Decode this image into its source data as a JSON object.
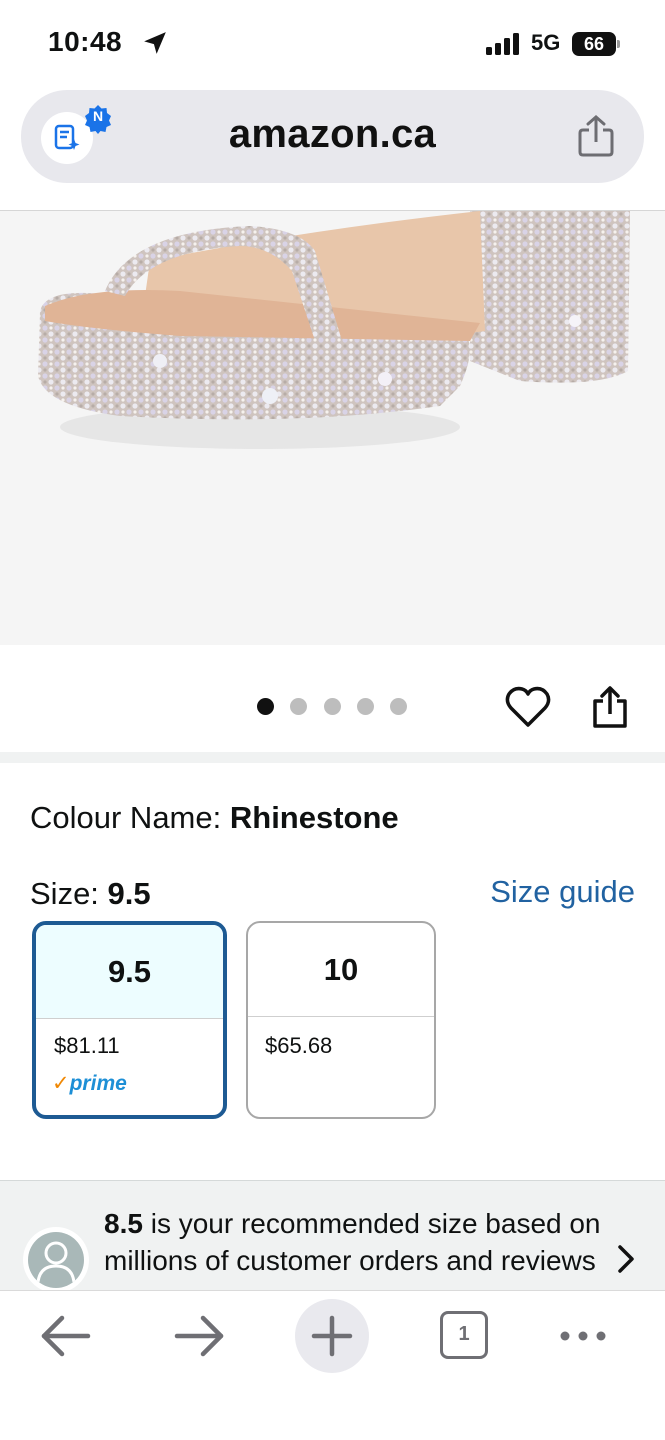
{
  "status_bar": {
    "time": "10:48",
    "network": "5G",
    "battery": "66"
  },
  "browser": {
    "url": "amazon.ca",
    "badge": "N",
    "tab_count": "1"
  },
  "product": {
    "image_alt": "Rhinestone platform heel sandal",
    "carousel_dots": 5,
    "carousel_active": 0,
    "colour_label": "Colour Name:",
    "colour_value": "Rhinestone",
    "size_label": "Size:",
    "size_value": "9.5",
    "size_guide": "Size guide",
    "sizes": [
      {
        "size": "9.5",
        "price": "$81.11",
        "prime": "prime",
        "selected": true
      },
      {
        "size": "10",
        "price": "$65.68",
        "prime": "",
        "selected": false
      }
    ]
  },
  "recommendation": {
    "size": "8.5",
    "text": " is your recommended size based on millions of customer orders and reviews"
  },
  "colors": {
    "link": "#2162a1",
    "selected_border": "#1d5a93",
    "selected_bg": "#edfdff",
    "prime_blue": "#1d8fd6",
    "prime_check": "#f08804"
  },
  "icons": {
    "location": "location-arrow-icon",
    "signal": "cellular-signal-icon",
    "share": "share-icon",
    "heart": "heart-icon",
    "back": "back-arrow-icon",
    "forward": "forward-arrow-icon",
    "new_tab": "plus-icon",
    "tabs": "tabs-icon",
    "more": "more-icon",
    "chevron": "chevron-right-icon"
  }
}
